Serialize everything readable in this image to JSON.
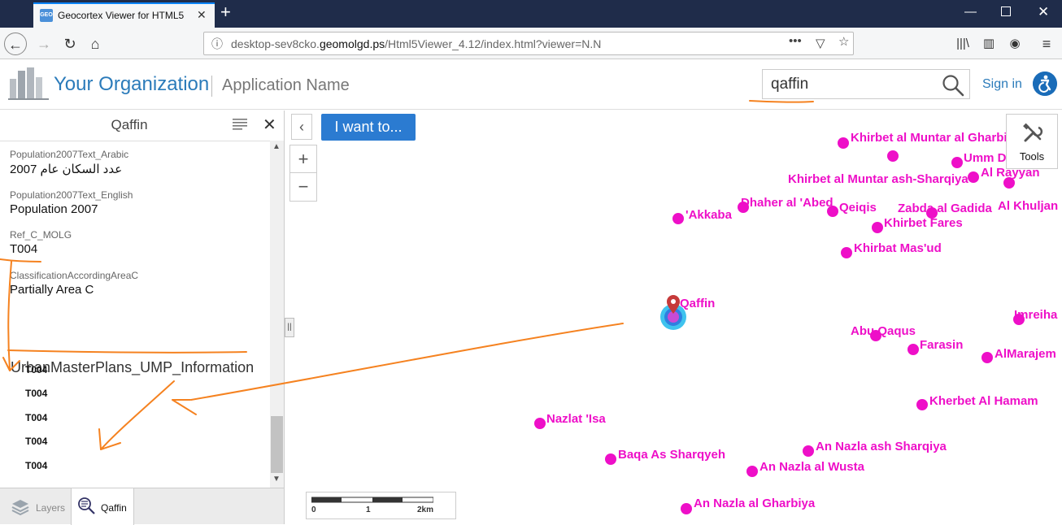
{
  "browser": {
    "tab_title": "Geocortex Viewer for HTML5",
    "favicon_text": "GEO",
    "url_prefix": "desktop-sev8cko.",
    "url_domain": "geomolgd.ps",
    "url_path": "/Html5Viewer_4.12/index.html?viewer=N.N"
  },
  "header": {
    "org_name": "Your Organization",
    "app_name": "Application Name",
    "search_value": "qaffin",
    "signin_label": "Sign in",
    "colors": {
      "brand": "#2b7bba",
      "accessibility": "#1a6cb8"
    }
  },
  "panel": {
    "title": "Qaffin",
    "fields": [
      {
        "name": "Population2007Text_Arabic",
        "value": "عدد السكان عام 2007"
      },
      {
        "name": "Population2007Text_English",
        "value": "Population 2007"
      },
      {
        "name": "Ref_C_MOLG",
        "value": "T004"
      },
      {
        "name": "ClassificationAccordingAreaC",
        "value": "Partially Area C"
      }
    ],
    "section_heading": "UrbanMasterPlans_UMP_Information",
    "section_items": [
      "T004",
      "T004",
      "T004",
      "T004",
      "T004"
    ],
    "tabs": [
      {
        "label": "Layers",
        "icon": "layers-icon"
      },
      {
        "label": "Qaffin",
        "icon": "results-list-icon"
      }
    ]
  },
  "map": {
    "iwant_label": "I want to...",
    "tools_label": "Tools",
    "selected_place": "Qaffin",
    "place_color": "#ee0fc8",
    "annotation_color": "#f58220",
    "scale_labels": [
      "0",
      "1",
      "2km"
    ],
    "places": [
      {
        "name": "Khirbet al Muntar al Gharbiya"
      },
      {
        "name": "Umm Dar"
      },
      {
        "name": "Khirbet al Muntar ash-Sharqiya"
      },
      {
        "name": "Al Rayyan"
      },
      {
        "name": "Al Khuljan"
      },
      {
        "name": "'Akkaba"
      },
      {
        "name": "Dhaher al 'Abed"
      },
      {
        "name": "Qeiqis"
      },
      {
        "name": "Zabda al Gadida"
      },
      {
        "name": "Khirbet Fares"
      },
      {
        "name": "Khirbat Mas'ud"
      },
      {
        "name": "Imreiha"
      },
      {
        "name": "Abu Qaqus"
      },
      {
        "name": "Farasin"
      },
      {
        "name": "AlMarajem"
      },
      {
        "name": "Kherbet Al Hamam"
      },
      {
        "name": "Nazlat 'Isa"
      },
      {
        "name": "An Nazla ash Sharqiya"
      },
      {
        "name": "Baqa As Sharqyeh"
      },
      {
        "name": "An Nazla al Wusta"
      },
      {
        "name": "An Nazla al Gharbiya"
      }
    ]
  }
}
